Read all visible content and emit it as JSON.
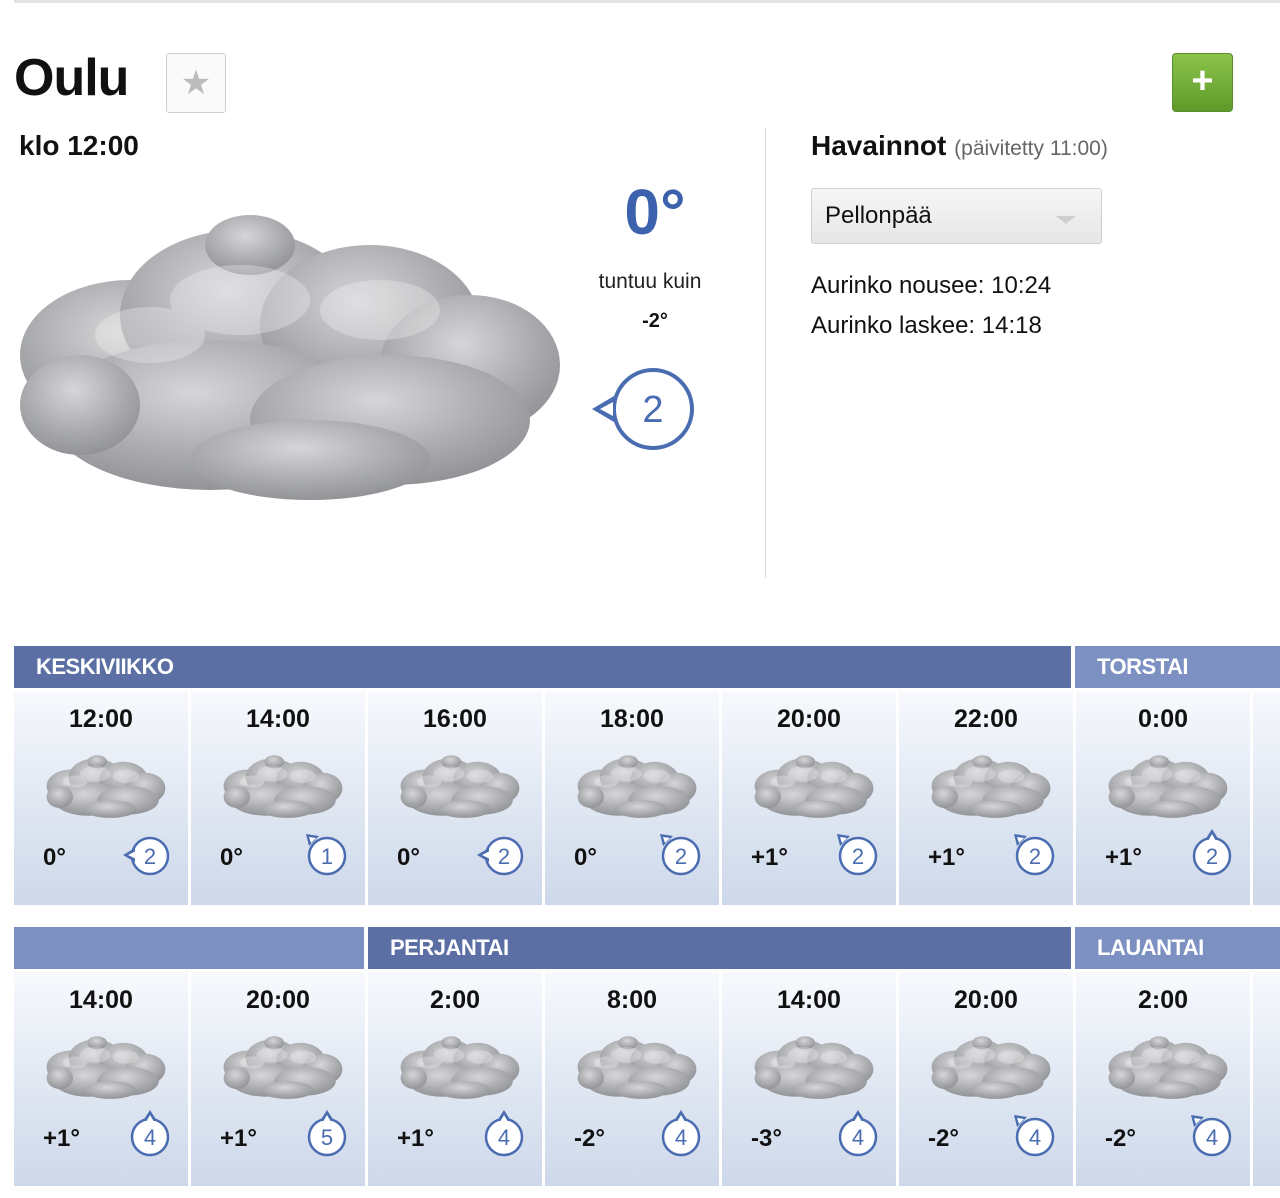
{
  "location": {
    "city": "Oulu",
    "favorite_icon": "star-icon",
    "add_icon": "plus-icon"
  },
  "current": {
    "time_label": "klo 12:00",
    "weather_icon": "cloudy-icon",
    "temperature": "0°",
    "feels_like_label": "tuntuu kuin",
    "feels_like_value": "-2°",
    "wind_speed": "2",
    "wind_icon": "wind-direction-icon"
  },
  "observations": {
    "title": "Havainnot",
    "updated": "(päivitetty 11:00)",
    "station": "Pellonpää",
    "sunrise": "Aurinko nousee: 10:24",
    "sunset": "Aurinko laskee: 14:18"
  },
  "forecast": {
    "row1": {
      "days": [
        {
          "label": "KESKIVIIKKO"
        },
        {
          "label": "TORSTAI"
        }
      ],
      "items": [
        {
          "time": "12:00",
          "temp": "0°",
          "wind": "2",
          "dir": "left"
        },
        {
          "time": "14:00",
          "temp": "0°",
          "wind": "1",
          "dir": "upleft"
        },
        {
          "time": "16:00",
          "temp": "0°",
          "wind": "2",
          "dir": "left"
        },
        {
          "time": "18:00",
          "temp": "0°",
          "wind": "2",
          "dir": "upleft"
        },
        {
          "time": "20:00",
          "temp": "+1°",
          "wind": "2",
          "dir": "upleft"
        },
        {
          "time": "22:00",
          "temp": "+1°",
          "wind": "2",
          "dir": "upleft"
        },
        {
          "time": "0:00",
          "temp": "+1°",
          "wind": "2",
          "dir": "up"
        }
      ]
    },
    "row2": {
      "days": [
        {
          "label": ""
        },
        {
          "label": "PERJANTAI"
        },
        {
          "label": "LAUANTAI"
        }
      ],
      "items": [
        {
          "time": "14:00",
          "temp": "+1°",
          "wind": "4",
          "dir": "up"
        },
        {
          "time": "20:00",
          "temp": "+1°",
          "wind": "5",
          "dir": "up"
        },
        {
          "time": "2:00",
          "temp": "+1°",
          "wind": "4",
          "dir": "up"
        },
        {
          "time": "8:00",
          "temp": "-2°",
          "wind": "4",
          "dir": "up"
        },
        {
          "time": "14:00",
          "temp": "-3°",
          "wind": "4",
          "dir": "up"
        },
        {
          "time": "20:00",
          "temp": "-2°",
          "wind": "4",
          "dir": "upleft"
        },
        {
          "time": "2:00",
          "temp": "-2°",
          "wind": "4",
          "dir": "upleft"
        }
      ]
    }
  },
  "colors": {
    "day_bar_dark": "#5b6fa4",
    "day_bar_light": "#7d90c2",
    "temp_blue": "#3d62ad",
    "wind_blue": "#4a6cb0",
    "add_green": "#70ad35"
  }
}
